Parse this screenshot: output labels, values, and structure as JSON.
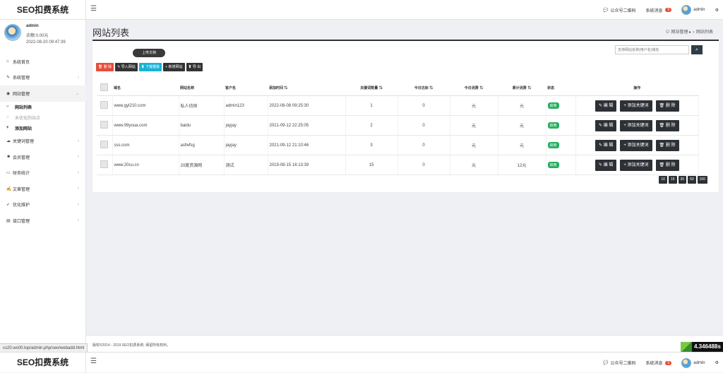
{
  "app": {
    "title": "SEO扣费系统",
    "menu_icon": "☰"
  },
  "topbar": {
    "wechat_label": "公众号二维码",
    "messages_label": "系统消息",
    "messages_count": "0",
    "user": "admin"
  },
  "profile": {
    "name": "admin",
    "balance": "余额:0.00元",
    "time": "2022-08-20 09:47:39"
  },
  "sidebar": {
    "items": [
      {
        "label": "系统首页",
        "icon": "home-icon"
      },
      {
        "label": "系统管理",
        "icon": "wrench-icon"
      },
      {
        "label": "网站管理",
        "icon": "globe-icon"
      },
      {
        "label": "关键词管理",
        "icon": "cloud-icon"
      },
      {
        "label": "会员管理",
        "icon": "users-icon"
      },
      {
        "label": "财务统计",
        "icon": "card-icon"
      },
      {
        "label": "文章管理",
        "icon": "edit-icon"
      },
      {
        "label": "优化维护",
        "icon": "rocket-icon"
      },
      {
        "label": "接口管理",
        "icon": "api-icon"
      }
    ],
    "subitems": [
      {
        "label": "网站列表"
      },
      {
        "label": "未优化的站点"
      },
      {
        "label": "添加网站"
      }
    ]
  },
  "page": {
    "title": "网站列表",
    "breadcrumb_home": "网站管理",
    "breadcrumb_sep": "▸",
    "breadcrumb_current": "网站列表"
  },
  "toolbar": {
    "upload": "上传文档",
    "delete": "删 除",
    "import": "导入网站",
    "download": "下载模板",
    "add": "新增网站",
    "export": "导 出"
  },
  "search": {
    "placeholder": "支持网站名称(用户名)域名"
  },
  "table": {
    "headers": [
      "域名",
      "网站名称",
      "客户名",
      "添加时间",
      "关键词数量",
      "今日达标",
      "今日消费",
      "累计消费",
      "状态",
      "操作"
    ],
    "rows": [
      {
        "domain": "www.gyl210.com",
        "name": "私人侦探",
        "client": "admin123",
        "time": "2022-08-08 09:25:30",
        "keywords": "1",
        "today_hit": "0",
        "today_cost": "元",
        "total_cost": "元",
        "status": "启用"
      },
      {
        "domain": "www.99youa.com",
        "name": "baidu",
        "client": "jayjay",
        "time": "2021-09-12 22:25:05",
        "keywords": "2",
        "today_hit": "0",
        "today_cost": "元",
        "total_cost": "元",
        "status": "启用"
      },
      {
        "domain": "sss.com",
        "name": "asfwfsg",
        "client": "jayjay",
        "time": "2021-09-12 21:10:46",
        "keywords": "3",
        "today_hit": "0",
        "today_cost": "元",
        "total_cost": "元",
        "status": "启用"
      },
      {
        "domain": "www.20cu.cn",
        "name": "20度资源网",
        "client": "测试",
        "time": "2019-08-15 16:13:39",
        "keywords": "15",
        "today_hit": "0",
        "today_cost": "元",
        "total_cost": "12元",
        "status": "启用"
      }
    ],
    "ops": {
      "edit": "编 辑",
      "add_kw": "添加关键词",
      "delete": "删 除"
    }
  },
  "pager": [
    "10",
    "15",
    "30",
    "50",
    "100"
  ],
  "footer": {
    "text": "版权©2014 - 2019 SEO扣费系统, 保留所有权利。"
  },
  "statusbar": {
    "url": "cs20.ws00.top/admin.php/seo/webadd.html"
  },
  "timer": "4.346488s"
}
